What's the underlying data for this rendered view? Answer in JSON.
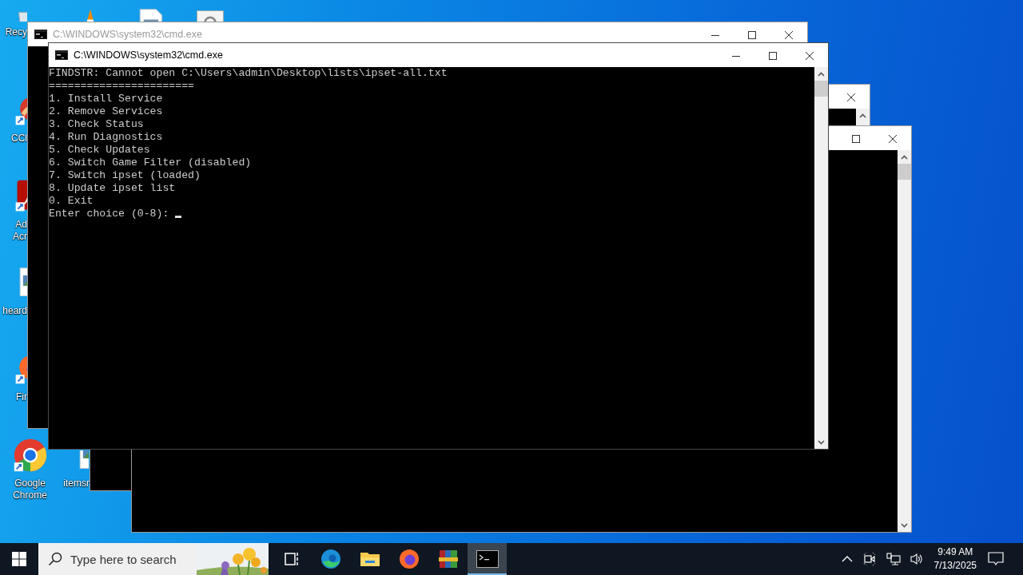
{
  "desktop": {
    "icons": [
      {
        "kind": "recycle-bin",
        "lines": [
          "Recy"
        ]
      },
      {
        "kind": "traffic-cone"
      },
      {
        "kind": "document"
      },
      {
        "kind": "settings-window"
      },
      {
        "kind": "ccleaner",
        "lines": [
          "CCl"
        ]
      },
      {
        "kind": "acrobat",
        "lines": [
          "Ad",
          "Acr"
        ]
      },
      {
        "kind": "image-file",
        "lines": [
          "heard"
        ]
      },
      {
        "kind": "firefox",
        "lines": [
          "Fir"
        ]
      },
      {
        "kind": "chrome",
        "lines": [
          "Google",
          "Chrome"
        ]
      },
      {
        "kind": "image-file",
        "lines": [
          "itemsr"
        ]
      }
    ]
  },
  "windows": [
    {
      "active": false,
      "buttons": [
        {
          "kind": "close"
        }
      ]
    },
    {
      "active": false,
      "buttons": [
        {
          "kind": "maximize"
        },
        {
          "kind": "close"
        }
      ]
    },
    {
      "active": false,
      "title": "C:\\WINDOWS\\system32\\cmd.exe",
      "buttons": [
        {
          "kind": "minimize"
        },
        {
          "kind": "maximize"
        },
        {
          "kind": "close"
        }
      ]
    },
    {
      "active": true,
      "title": "C:\\WINDOWS\\system32\\cmd.exe",
      "buttons": [
        {
          "kind": "minimize"
        },
        {
          "kind": "maximize"
        },
        {
          "kind": "close"
        }
      ],
      "lines": [
        "FINDSTR: Cannot open C:\\Users\\admin\\Desktop\\lists\\ipset-all.txt",
        "=======================",
        "1. Install Service",
        "2. Remove Services",
        "3. Check Status",
        "4. Run Diagnostics",
        "5. Check Updates",
        "6. Switch Game Filter (disabled)",
        "7. Switch ipset (loaded)",
        "8. Update ipset list",
        "0. Exit"
      ],
      "prompt": "Enter choice (0-8):",
      "cursor": true
    }
  ],
  "taskbar": {
    "search": {
      "placeholder": "Type here to search"
    },
    "apps": [
      {
        "kind": "task-view",
        "selected": false
      },
      {
        "kind": "edge",
        "selected": false
      },
      {
        "kind": "explorer",
        "selected": false
      },
      {
        "kind": "firefox",
        "selected": false
      },
      {
        "kind": "winrar",
        "selected": false
      },
      {
        "kind": "terminal",
        "selected": true
      }
    ],
    "tray": [
      {
        "kind": "chevron-up"
      },
      {
        "kind": "meet-now"
      },
      {
        "kind": "network"
      },
      {
        "kind": "volume"
      }
    ],
    "clock": {
      "time": "9:49 AM",
      "date": "7/13/2025"
    }
  }
}
